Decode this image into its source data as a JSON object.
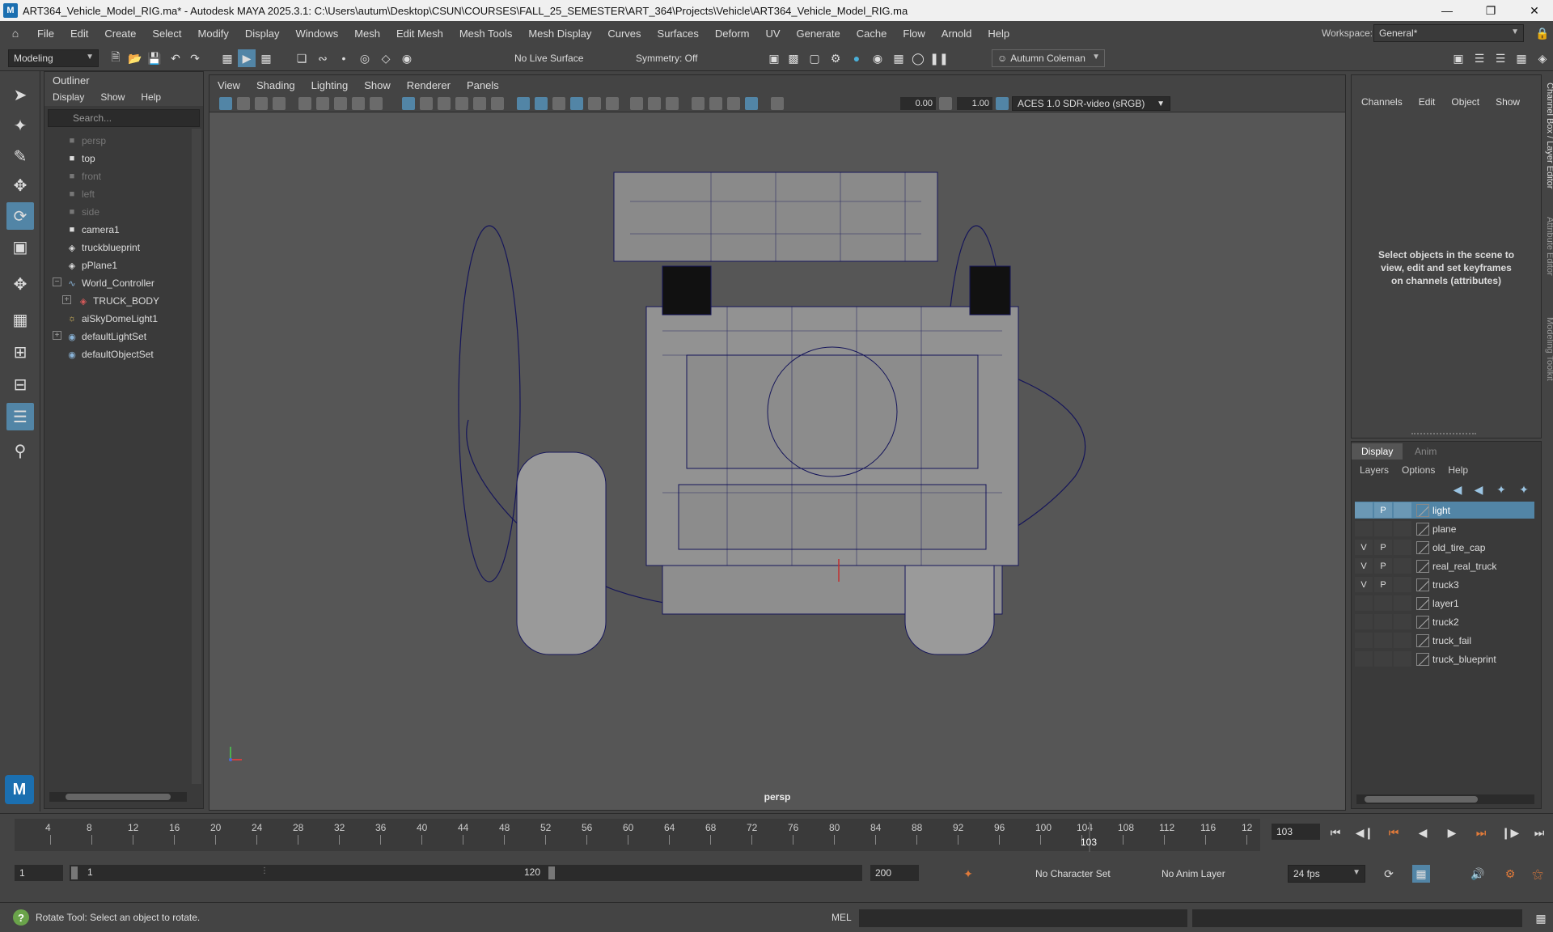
{
  "window": {
    "title": "ART364_Vehicle_Model_RIG.ma* - Autodesk MAYA 2025.3.1: C:\\Users\\autum\\Desktop\\CSUN\\COURSES\\FALL_25_SEMESTER\\ART_364\\Projects\\Vehicle\\ART364_Vehicle_Model_RIG.ma",
    "logo": "M",
    "minimize": "—",
    "maximize": "❐",
    "close": "✕"
  },
  "menubar": [
    "File",
    "Edit",
    "Create",
    "Select",
    "Modify",
    "Display",
    "Windows",
    "Mesh",
    "Edit Mesh",
    "Mesh Tools",
    "Mesh Display",
    "Curves",
    "Surfaces",
    "Deform",
    "UV",
    "Generate",
    "Cache",
    "Flow",
    "Arnold",
    "Help"
  ],
  "workspace": {
    "label": "Workspace:",
    "value": "General*"
  },
  "shelf": {
    "mode": "Modeling",
    "live_surface": "No Live Surface",
    "symmetry": "Symmetry: Off",
    "user": "Autumn Coleman"
  },
  "outliner": {
    "title": "Outliner",
    "menu": [
      "Display",
      "Show",
      "Help"
    ],
    "search_placeholder": "Search...",
    "items": [
      {
        "label": "persp",
        "icon": "camera-icon",
        "dim": true
      },
      {
        "label": "top",
        "icon": "camera-icon",
        "dim": false
      },
      {
        "label": "front",
        "icon": "camera-icon",
        "dim": true
      },
      {
        "label": "left",
        "icon": "camera-icon",
        "dim": true
      },
      {
        "label": "side",
        "icon": "camera-icon",
        "dim": true
      },
      {
        "label": "camera1",
        "icon": "camera-icon",
        "dim": false
      },
      {
        "label": "truckblueprint",
        "icon": "mesh-icon",
        "dim": false
      },
      {
        "label": "pPlane1",
        "icon": "mesh-icon",
        "dim": false
      },
      {
        "label": "World_Controller",
        "icon": "curve-icon",
        "dim": false
      },
      {
        "label": "TRUCK_BODY",
        "icon": "mesh-icon",
        "dim": false
      },
      {
        "label": "aiSkyDomeLight1",
        "icon": "light-icon",
        "dim": false
      },
      {
        "label": "defaultLightSet",
        "icon": "set-icon",
        "dim": false
      },
      {
        "label": "defaultObjectSet",
        "icon": "set-icon",
        "dim": false
      }
    ]
  },
  "viewport": {
    "menu": [
      "View",
      "Shading",
      "Lighting",
      "Show",
      "Renderer",
      "Panels"
    ],
    "exposure": "0.00",
    "gamma": "1.00",
    "color_space": "ACES 1.0 SDR-video (sRGB)",
    "camera_label": "persp"
  },
  "channel_box": {
    "tabs": [
      "Channels",
      "Edit",
      "Object",
      "Show"
    ],
    "hint": "Select objects in the scene to view, edit and set keyframes on channels (attributes)",
    "side_tabs": [
      "Channel Box / Layer Editor",
      "Attribute Editor",
      "Modeling Toolkit"
    ]
  },
  "layer_editor": {
    "tabs": [
      "Display",
      "Anim"
    ],
    "menu": [
      "Layers",
      "Options",
      "Help"
    ],
    "layers": [
      {
        "name": "light",
        "v": "",
        "p": "P",
        "selected": true
      },
      {
        "name": "plane",
        "v": "",
        "p": "",
        "selected": false
      },
      {
        "name": "old_tire_cap",
        "v": "V",
        "p": "P",
        "selected": false
      },
      {
        "name": "real_real_truck",
        "v": "V",
        "p": "P",
        "selected": false
      },
      {
        "name": "truck3",
        "v": "V",
        "p": "P",
        "selected": false
      },
      {
        "name": "layer1",
        "v": "",
        "p": "",
        "selected": false
      },
      {
        "name": "truck2",
        "v": "",
        "p": "",
        "selected": false
      },
      {
        "name": "truck_fail",
        "v": "",
        "p": "",
        "selected": false
      },
      {
        "name": "truck_blueprint",
        "v": "",
        "p": "",
        "selected": false
      }
    ]
  },
  "timeline": {
    "tick_labels": [
      "4",
      "8",
      "12",
      "16",
      "20",
      "24",
      "28",
      "32",
      "36",
      "40",
      "44",
      "48",
      "52",
      "56",
      "60",
      "64",
      "68",
      "72",
      "76",
      "80",
      "84",
      "88",
      "92",
      "96",
      "100",
      "104",
      "108",
      "112",
      "116",
      "12"
    ],
    "current_frame_marker": "103",
    "current_frame_field": "103"
  },
  "range": {
    "start": "1",
    "range_start": "1",
    "range_end": "120",
    "end": "200",
    "character_set": "No Character Set",
    "anim_layer": "No Anim Layer",
    "fps": "24 fps"
  },
  "status": {
    "message": "Rotate Tool: Select an object to rotate.",
    "mel_label": "MEL"
  },
  "colors": {
    "accent": "#5285a6",
    "wire": "#15155a",
    "background": "#444444"
  }
}
